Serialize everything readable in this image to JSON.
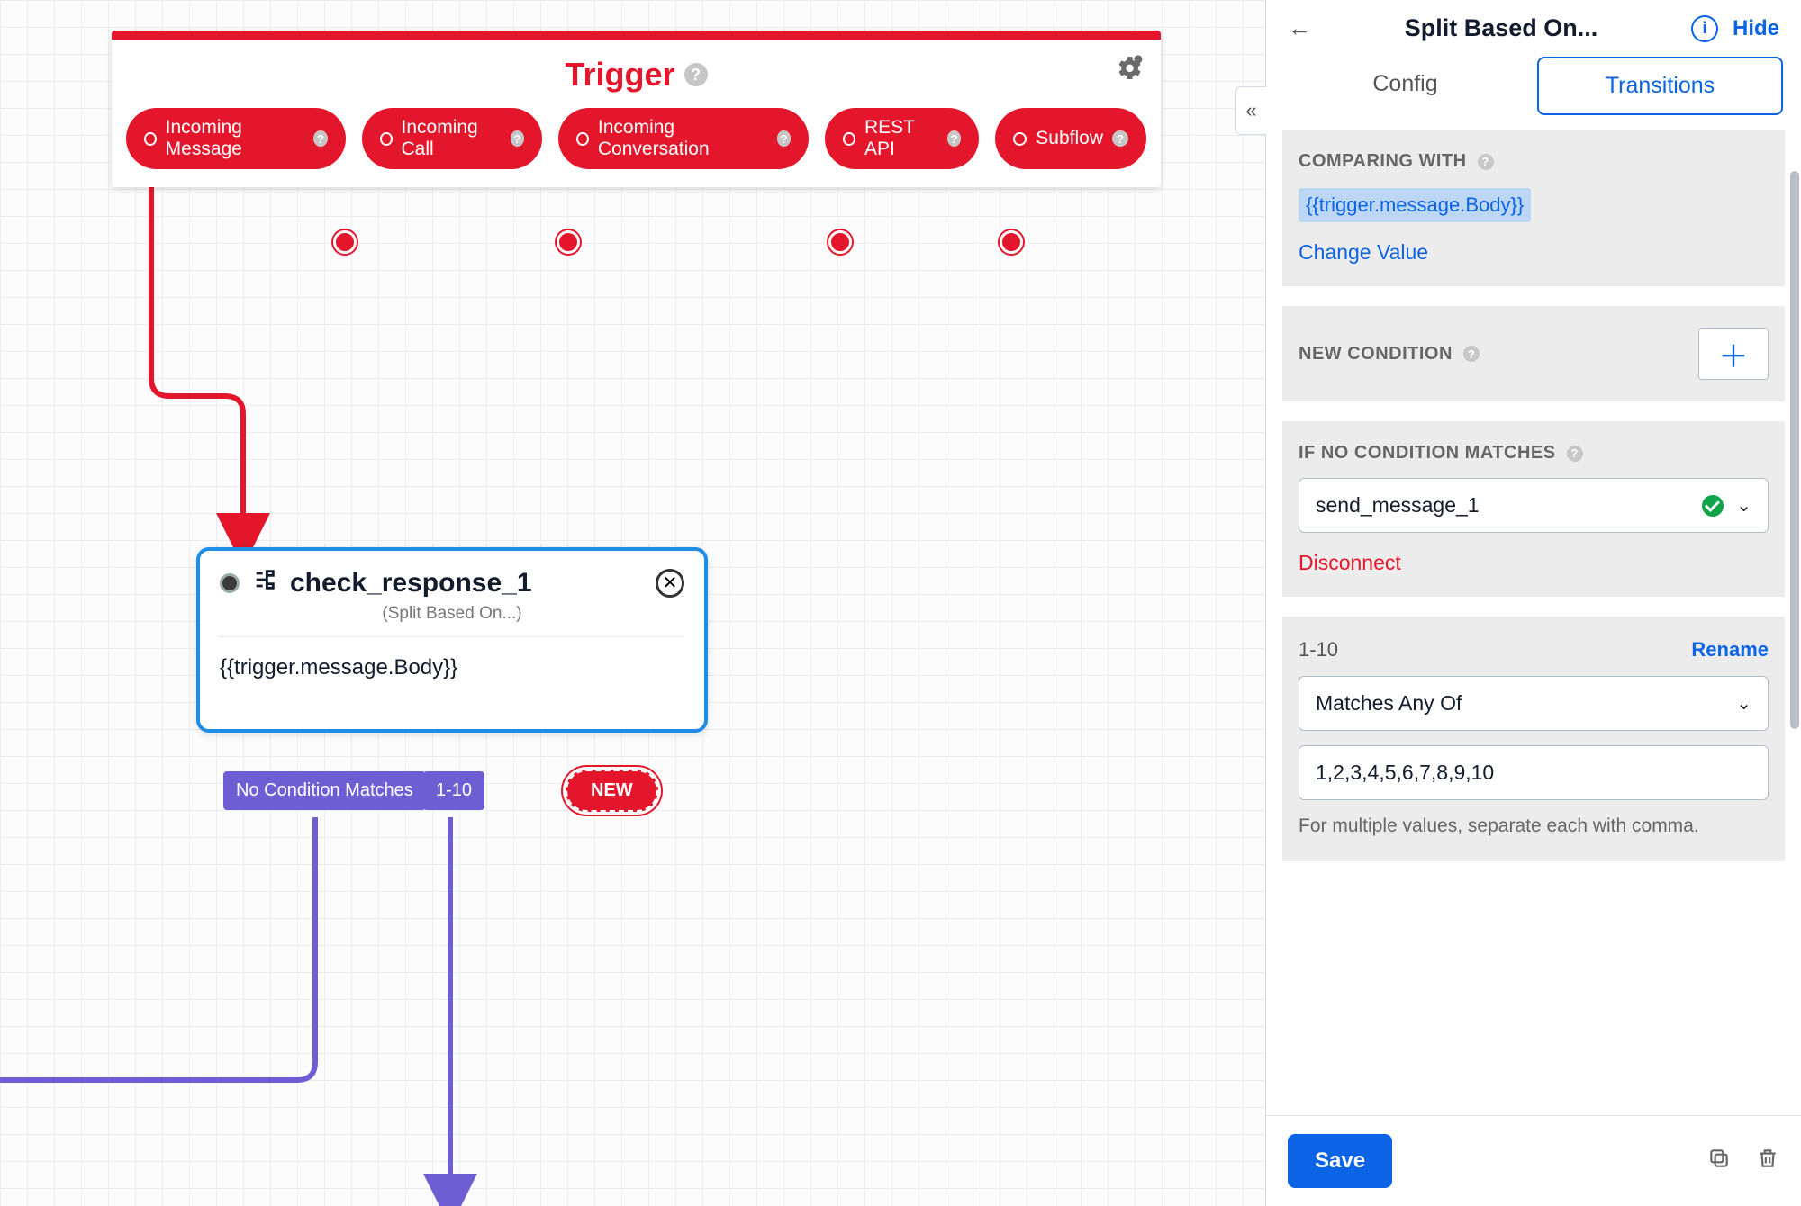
{
  "canvas": {
    "trigger": {
      "title": "Trigger",
      "pills": [
        "Incoming Message",
        "Incoming Call",
        "Incoming Conversation",
        "REST API",
        "Subflow"
      ]
    },
    "splitNode": {
      "title": "check_response_1",
      "subtitle": "(Split Based On...)",
      "body": "{{trigger.message.Body}}",
      "tags": {
        "noMatch": "No Condition Matches",
        "cond": "1-10",
        "new": "NEW"
      }
    }
  },
  "panel": {
    "title": "Split Based On...",
    "hide": "Hide",
    "tabs": {
      "config": "Config",
      "transitions": "Transitions"
    },
    "comparing": {
      "label": "COMPARING WITH",
      "token": "{{trigger.message.Body}}",
      "change": "Change Value"
    },
    "newCondition": {
      "label": "NEW CONDITION"
    },
    "noMatch": {
      "label": "IF NO CONDITION MATCHES",
      "value": "send_message_1",
      "disconnect": "Disconnect"
    },
    "condition": {
      "name": "1-10",
      "rename": "Rename",
      "operator": "Matches Any Of",
      "value": "1,2,3,4,5,6,7,8,9,10",
      "hint": "For multiple values, separate each with comma."
    },
    "save": "Save"
  }
}
